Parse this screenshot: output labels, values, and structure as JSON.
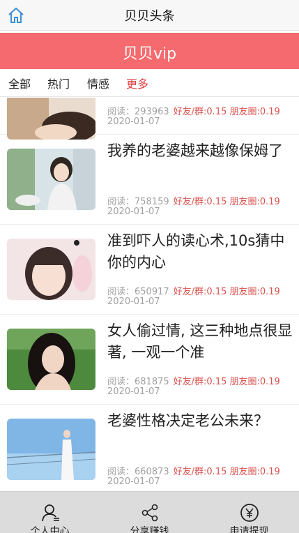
{
  "header": {
    "title": "贝贝头条",
    "home_icon": "home-icon"
  },
  "banner": {
    "title": "贝贝vip",
    "color": "#f56a6e"
  },
  "tabs": [
    {
      "label": "全部",
      "active": false
    },
    {
      "label": "热门",
      "active": false
    },
    {
      "label": "情感",
      "active": false
    },
    {
      "label": "更多",
      "active": true
    }
  ],
  "articles": [
    {
      "title": "",
      "read_label": "阅读：",
      "reads": "293963",
      "price": "好友/群:0.15 朋友圈:0.19",
      "date": "2020-01-07"
    },
    {
      "title": "我养的老婆越来越像保姆了",
      "read_label": "阅读：",
      "reads": "758159",
      "price": "好友/群:0.15 朋友圈:0.19",
      "date": "2020-01-07"
    },
    {
      "title": "准到吓人的读心术,10s猜中你的内心",
      "read_label": "阅读：",
      "reads": "650917",
      "price": "好友/群:0.15 朋友圈:0.19",
      "date": "2020-01-07"
    },
    {
      "title": "女人偷过情, 这三种地点很显著, 一观一个准",
      "read_label": "阅读：",
      "reads": "681875",
      "price": "好友/群:0.15 朋友圈:0.19",
      "date": "2020-01-07"
    },
    {
      "title": "老婆性格决定老公未来？",
      "read_label": "阅读：",
      "reads": "660873",
      "price": "好友/群:0.15 朋友圈:0.19",
      "date": "2020-01-07"
    }
  ],
  "bottom_nav": [
    {
      "label": "个人中心",
      "icon": "user-icon"
    },
    {
      "label": "分享赚钱",
      "icon": "share-icon"
    },
    {
      "label": "申请提现",
      "icon": "yen-icon"
    }
  ]
}
